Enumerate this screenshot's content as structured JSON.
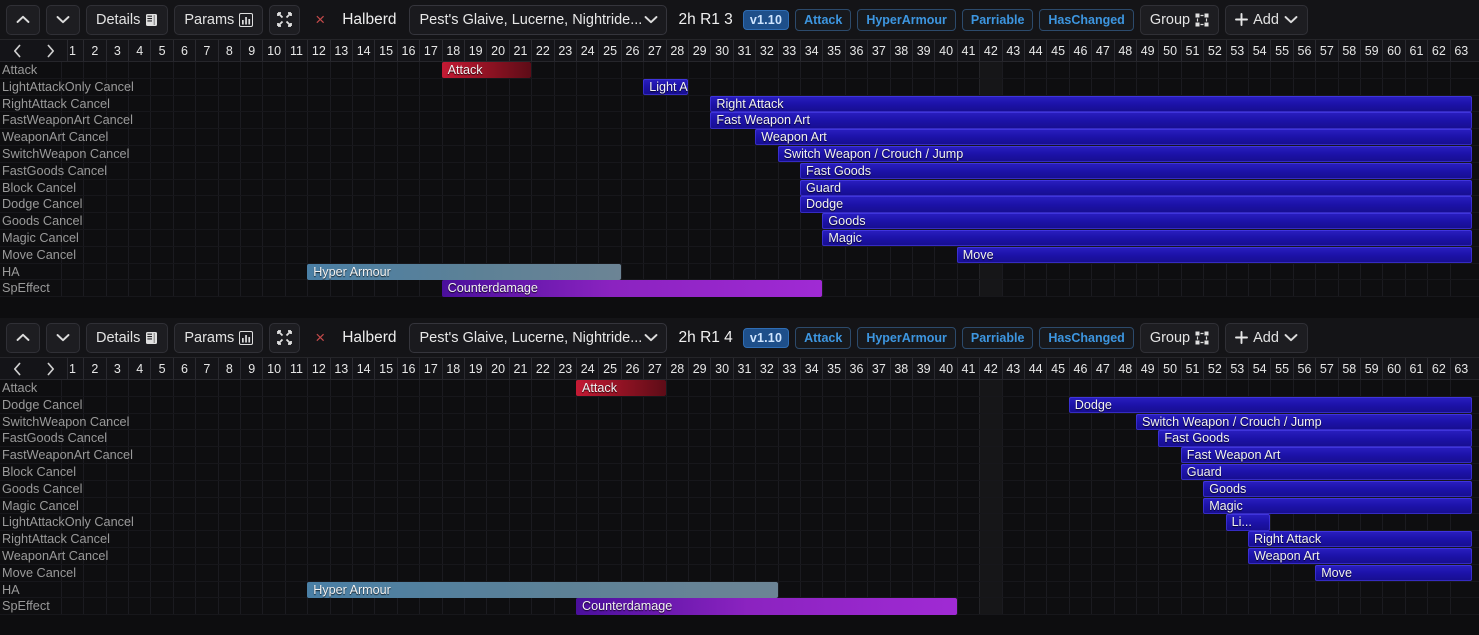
{
  "timeline": {
    "frame_start": 1,
    "frame_end": 63,
    "hover_frame": 42,
    "nav_prev": "‹",
    "nav_next": "›",
    "frames": [
      1,
      2,
      3,
      4,
      5,
      6,
      7,
      8,
      9,
      10,
      11,
      12,
      13,
      14,
      15,
      16,
      17,
      18,
      19,
      20,
      21,
      22,
      23,
      24,
      25,
      26,
      27,
      28,
      29,
      30,
      31,
      32,
      33,
      34,
      35,
      36,
      37,
      38,
      39,
      40,
      41,
      42,
      43,
      44,
      45,
      46,
      47,
      48,
      49,
      50,
      51,
      52,
      53,
      54,
      55,
      56,
      57,
      58,
      59,
      60,
      61,
      62,
      63
    ]
  },
  "colors": {
    "accent_blue": "#3d96e0",
    "attack_red": "#c41a34",
    "cancel_blue": "#2a1fc0",
    "hyperarmour": "#4a7fa5",
    "speffect_purple": "#a02ad4",
    "close_red": "#c34a4a",
    "toolbar_bg": "#141417",
    "grid_bg": "#0e0e10"
  },
  "panels": [
    {
      "toolbar": {
        "up_label": "▲",
        "down_label": "▼",
        "details_label": "Details",
        "details_icon": "book-icon",
        "params_label": "Params",
        "params_icon": "bar-chart-icon",
        "collapse_icon": "collapse-icon",
        "close_label": "×",
        "weapon_class": "Halberd",
        "weapon_select_value": "Pest's Glaive, Lucerne, Nightride...",
        "chevron": "∨",
        "move_id": "2h R1 3",
        "version": "v1.10",
        "flags": [
          "Attack",
          "HyperArmour",
          "Parriable",
          "HasChanged"
        ],
        "group_label": "Group",
        "group_icon": "group-icon",
        "add_label": "Add",
        "add_plus": "+",
        "add_chevron": "∨"
      },
      "rows": [
        {
          "label": "Attack",
          "bars": [
            {
              "text": "Attack",
              "type": "attack",
              "start": 18,
              "end": 22
            }
          ]
        },
        {
          "label": "LightAttackOnly Cancel",
          "bars": [
            {
              "text": "Light Atta...",
              "type": "cancel",
              "start": 27,
              "end": 29
            }
          ]
        },
        {
          "label": "RightAttack Cancel",
          "bars": [
            {
              "text": "Right Attack",
              "type": "cancel",
              "start": 30,
              "end": 64
            }
          ]
        },
        {
          "label": "FastWeaponArt Cancel",
          "bars": [
            {
              "text": "Fast Weapon Art",
              "type": "cancel",
              "start": 30,
              "end": 64
            }
          ]
        },
        {
          "label": "WeaponArt Cancel",
          "bars": [
            {
              "text": "Weapon Art",
              "type": "cancel",
              "start": 32,
              "end": 64
            }
          ]
        },
        {
          "label": "SwitchWeapon Cancel",
          "bars": [
            {
              "text": "Switch Weapon / Crouch / Jump",
              "type": "cancel",
              "start": 33,
              "end": 64
            }
          ]
        },
        {
          "label": "FastGoods Cancel",
          "bars": [
            {
              "text": "Fast Goods",
              "type": "cancel",
              "start": 34,
              "end": 64
            }
          ]
        },
        {
          "label": "Block Cancel",
          "bars": [
            {
              "text": "Guard",
              "type": "cancel",
              "start": 34,
              "end": 64
            }
          ]
        },
        {
          "label": "Dodge Cancel",
          "bars": [
            {
              "text": "Dodge",
              "type": "cancel",
              "start": 34,
              "end": 64
            }
          ]
        },
        {
          "label": "Goods Cancel",
          "bars": [
            {
              "text": "Goods",
              "type": "cancel",
              "start": 35,
              "end": 64
            }
          ]
        },
        {
          "label": "Magic Cancel",
          "bars": [
            {
              "text": "Magic",
              "type": "cancel",
              "start": 35,
              "end": 64
            }
          ]
        },
        {
          "label": "Move Cancel",
          "bars": [
            {
              "text": "Move",
              "type": "cancel",
              "start": 41,
              "end": 64
            }
          ]
        },
        {
          "label": "HA",
          "bars": [
            {
              "text": "Hyper Armour",
              "type": "ha",
              "start": 12,
              "end": 26
            }
          ]
        },
        {
          "label": "SpEffect",
          "bars": [
            {
              "text": "Counterdamage",
              "type": "spfx",
              "start": 18,
              "end": 35
            }
          ]
        }
      ]
    },
    {
      "toolbar": {
        "up_label": "▲",
        "down_label": "▼",
        "details_label": "Details",
        "details_icon": "book-icon",
        "params_label": "Params",
        "params_icon": "bar-chart-icon",
        "collapse_icon": "collapse-icon",
        "close_label": "×",
        "weapon_class": "Halberd",
        "weapon_select_value": "Pest's Glaive, Lucerne, Nightride...",
        "chevron": "∨",
        "move_id": "2h R1 4",
        "version": "v1.10",
        "flags": [
          "Attack",
          "HyperArmour",
          "Parriable",
          "HasChanged"
        ],
        "group_label": "Group",
        "group_icon": "group-icon",
        "add_label": "Add",
        "add_plus": "+",
        "add_chevron": "∨"
      },
      "rows": [
        {
          "label": "Attack",
          "bars": [
            {
              "text": "Attack",
              "type": "attack",
              "start": 24,
              "end": 28
            }
          ]
        },
        {
          "label": "Dodge Cancel",
          "bars": [
            {
              "text": "Dodge",
              "type": "cancel",
              "start": 46,
              "end": 64
            }
          ]
        },
        {
          "label": "SwitchWeapon Cancel",
          "bars": [
            {
              "text": "Switch Weapon / Crouch / Jump",
              "type": "cancel",
              "start": 49,
              "end": 64
            }
          ]
        },
        {
          "label": "FastGoods Cancel",
          "bars": [
            {
              "text": "Fast Goods",
              "type": "cancel",
              "start": 50,
              "end": 64
            }
          ]
        },
        {
          "label": "FastWeaponArt Cancel",
          "bars": [
            {
              "text": "Fast Weapon Art",
              "type": "cancel",
              "start": 51,
              "end": 64
            }
          ]
        },
        {
          "label": "Block Cancel",
          "bars": [
            {
              "text": "Guard",
              "type": "cancel",
              "start": 51,
              "end": 64
            }
          ]
        },
        {
          "label": "Goods Cancel",
          "bars": [
            {
              "text": "Goods",
              "type": "cancel",
              "start": 52,
              "end": 64
            }
          ]
        },
        {
          "label": "Magic Cancel",
          "bars": [
            {
              "text": "Magic",
              "type": "cancel",
              "start": 52,
              "end": 64
            }
          ]
        },
        {
          "label": "LightAttackOnly Cancel",
          "bars": [
            {
              "text": "Li...",
              "type": "cancel",
              "start": 53,
              "end": 55
            }
          ]
        },
        {
          "label": "RightAttack Cancel",
          "bars": [
            {
              "text": "Right Attack",
              "type": "cancel",
              "start": 54,
              "end": 64
            }
          ]
        },
        {
          "label": "WeaponArt Cancel",
          "bars": [
            {
              "text": "Weapon Art",
              "type": "cancel",
              "start": 54,
              "end": 64
            }
          ]
        },
        {
          "label": "Move Cancel",
          "bars": [
            {
              "text": "Move",
              "type": "cancel",
              "start": 57,
              "end": 64
            }
          ]
        },
        {
          "label": "HA",
          "bars": [
            {
              "text": "Hyper Armour",
              "type": "ha",
              "start": 12,
              "end": 33
            }
          ]
        },
        {
          "label": "SpEffect",
          "bars": [
            {
              "text": "Counterdamage",
              "type": "spfx",
              "start": 24,
              "end": 41
            }
          ]
        }
      ]
    }
  ]
}
